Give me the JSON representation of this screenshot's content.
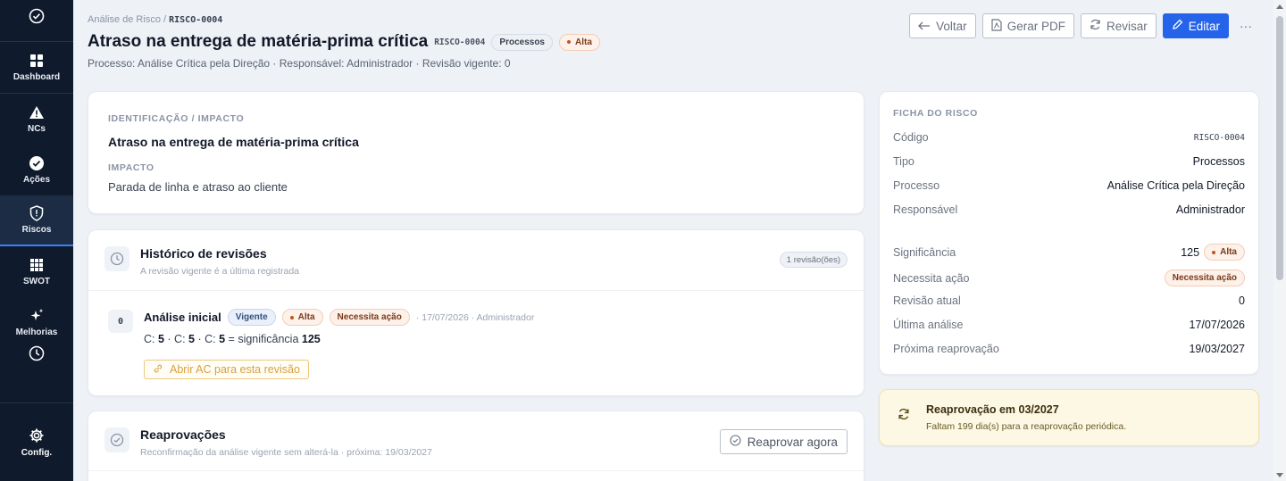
{
  "sidebar": {
    "items": [
      {
        "label": "Dashboard",
        "icon": "dashboard-grid-icon"
      },
      {
        "label": "NCs",
        "icon": "warning-triangle-icon"
      },
      {
        "label": "Ações",
        "icon": "check-circle-icon"
      },
      {
        "label": "Riscos",
        "icon": "shield-alert-icon",
        "active": true
      },
      {
        "label": "SWOT",
        "icon": "swot-grid-icon"
      },
      {
        "label": "Melhorias",
        "icon": "sparkles-icon"
      }
    ],
    "config_label": "Config."
  },
  "breadcrumb": {
    "parent": "Análise de Risco",
    "separator": "/",
    "current": "RISCO-0004"
  },
  "header": {
    "title": "Atraso na entrega de matéria-prima crítica",
    "code": "RISCO-0004",
    "type_badge": "Processos",
    "level_badge": "Alta",
    "subline": "Processo: Análise Crítica pela Direção · Responsável: Administrador · Revisão vigente: 0"
  },
  "actions": {
    "back": "Voltar",
    "pdf": "Gerar PDF",
    "review": "Revisar",
    "edit": "Editar",
    "more": "···"
  },
  "identification": {
    "label": "IDENTIFICAÇÃO / IMPACTO",
    "title": "Atraso na entrega de matéria-prima crítica",
    "impact_label": "IMPACTO",
    "impact_text": "Parada de linha e atraso ao cliente"
  },
  "history": {
    "title": "Histórico de revisões",
    "subtitle": "A revisão vigente é a última registrada",
    "count": "1 revisão(ões)",
    "revision": {
      "number": "0",
      "title": "Análise inicial",
      "badge_current": "Vigente",
      "badge_level": "Alta",
      "badge_action": "Necessita ação",
      "meta": "· 17/07/2026 · Administrador",
      "c1_prefix": "C:",
      "c1": "5",
      "c2_prefix": "· C:",
      "c2": "5",
      "c3_prefix": "· C:",
      "c3": "5",
      "sig_prefix": "= significância",
      "sig": "125",
      "ac_button": "Abrir AC para esta revisão"
    }
  },
  "reapprovals": {
    "title": "Reaprovações",
    "subtitle": "Reconfirmação da análise vigente sem alterá-la · próxima: 19/03/2027",
    "button": "Reaprovar agora"
  },
  "sheet": {
    "label": "FICHA DO RISCO",
    "code_k": "Código",
    "code_v": "RISCO-0004",
    "type_k": "Tipo",
    "type_v": "Processos",
    "process_k": "Processo",
    "process_v": "Análise Crítica pela Direção",
    "owner_k": "Responsável",
    "owner_v": "Administrador",
    "sig_k": "Significância",
    "sig_v": "125",
    "sig_badge": "Alta",
    "need_k": "Necessita ação",
    "need_badge": "Necessita ação",
    "rev_k": "Revisão atual",
    "rev_v": "0",
    "last_k": "Última análise",
    "last_v": "17/07/2026",
    "next_k": "Próxima reaprovação",
    "next_v": "19/03/2027"
  },
  "notice": {
    "title": "Reaprovação em 03/2027",
    "text": "Faltam 199 dia(s) para a reaprovação periódica."
  },
  "colors": {
    "primary": "#2563eb",
    "sidebar": "#0f1b2d",
    "warning": "#d9a13c"
  }
}
